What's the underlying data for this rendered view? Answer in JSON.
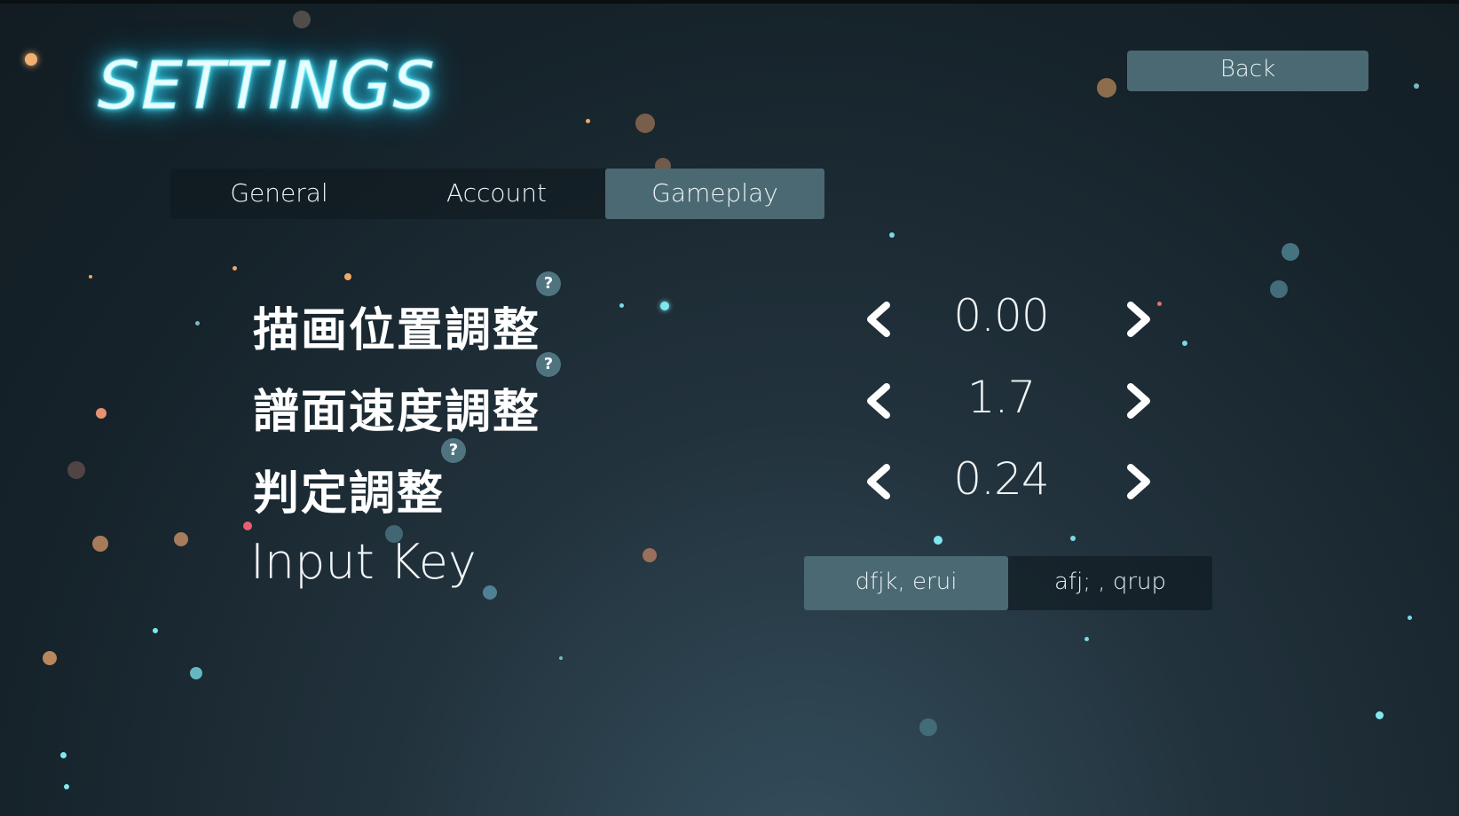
{
  "header": {
    "title": "SETTINGS",
    "back_label": "Back"
  },
  "tabs": [
    {
      "label": "General",
      "active": false
    },
    {
      "label": "Account",
      "active": false
    },
    {
      "label": "Gameplay",
      "active": true
    }
  ],
  "settings": [
    {
      "label": "描画位置調整",
      "value": "0.00",
      "help": "?"
    },
    {
      "label": "譜面速度調整",
      "value": "1.7",
      "help": "?"
    },
    {
      "label": "判定調整",
      "value": "0.24",
      "help": "?"
    }
  ],
  "input_key": {
    "label": "Input Key",
    "options": [
      {
        "label": "dfjk, erui",
        "selected": true
      },
      {
        "label": "afj; , qrup",
        "selected": false
      }
    ]
  },
  "colors": {
    "accent": "#4a6973",
    "title_glow": "#36d6f2",
    "background": "#16232b"
  },
  "icons": {
    "decrease": "chevron-left-icon",
    "increase": "chevron-right-icon",
    "help": "question-mark-icon"
  }
}
